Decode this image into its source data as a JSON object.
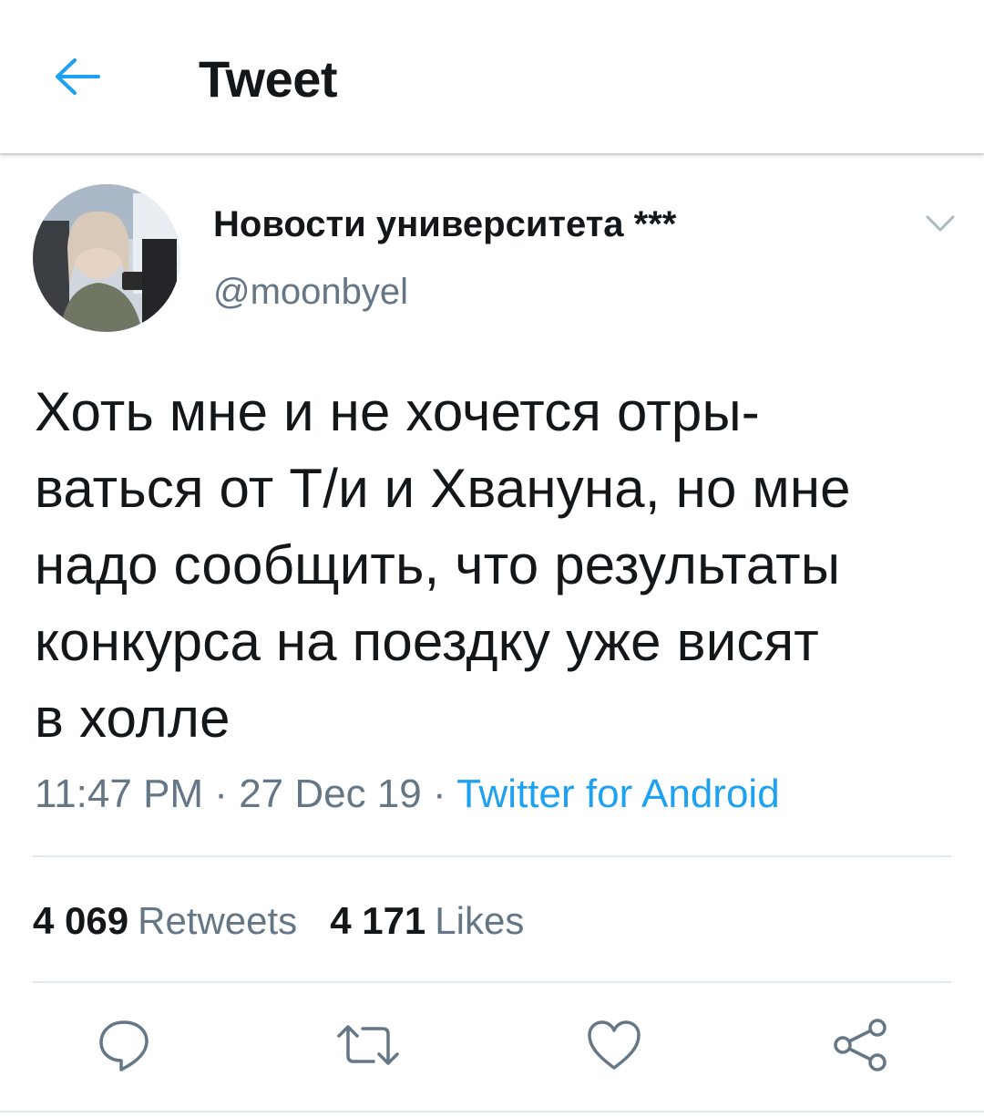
{
  "header": {
    "title": "Tweet",
    "back_icon": "arrow-left-icon"
  },
  "tweet": {
    "display_name": "Новости университета ***",
    "handle": "@moonbyel",
    "text": "Хоть мне и не хочется отры-\nваться от Т/и и Хвануна, но мне\nнадо сообщить, что результаты\nконкурса на поездку уже висят\nв холле",
    "time": "11:47 PM",
    "separator": " · ",
    "date": "27 Dec 19",
    "source": "Twitter for Android"
  },
  "stats": {
    "retweets_count": "4 069",
    "retweets_label": "Retweets",
    "likes_count": "4 171",
    "likes_label": "Likes"
  },
  "actions": [
    "reply-icon",
    "retweet-icon",
    "like-icon",
    "share-icon"
  ],
  "colors": {
    "accent": "#1da1f2",
    "text": "#14171a",
    "secondary": "#657786",
    "divider": "#e1e8ed",
    "icon": "#657786"
  }
}
